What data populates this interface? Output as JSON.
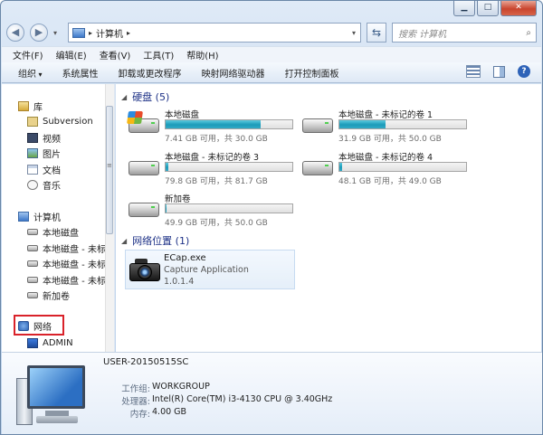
{
  "window": {
    "minimize": "▁",
    "maximize": "□",
    "close": "✕"
  },
  "nav": {
    "back": "◀",
    "forward": "▶",
    "history": "▾",
    "address": {
      "path": "计算机",
      "sep1": "▸",
      "sep2": "▸",
      "dropdown": "▾"
    },
    "refresh": "⇆",
    "search": {
      "placeholder": "搜索 计算机",
      "icon": "⌕"
    }
  },
  "menu": [
    "文件(F)",
    "编辑(E)",
    "查看(V)",
    "工具(T)",
    "帮助(H)"
  ],
  "toolbar": [
    "组织",
    "系统属性",
    "卸载或更改程序",
    "映射网络驱动器",
    "打开控制面板"
  ],
  "sidebar": {
    "library": "库",
    "library_items": [
      "Subversion",
      "视频",
      "图片",
      "文档",
      "音乐"
    ],
    "computer": "计算机",
    "computer_items": [
      "本地磁盘",
      "本地磁盘 - 未标记",
      "本地磁盘 - 未标记",
      "本地磁盘 - 未标记",
      "新加卷"
    ],
    "network": "网络",
    "network_items": [
      "ADMIN"
    ],
    "scroll_grip": "≡"
  },
  "content": {
    "hard_disks_title": "硬盘 (5)",
    "drives": [
      {
        "name": "本地磁盘",
        "free": "7.41 GB 可用，共 30.0 GB",
        "used_pct": 75.3
      },
      {
        "name": "本地磁盘 - 未标记的卷 1",
        "free": "31.9 GB 可用，共 50.0 GB",
        "used_pct": 36.2
      },
      {
        "name": "本地磁盘 - 未标记的卷 3",
        "free": "79.8 GB 可用，共 81.7 GB",
        "used_pct": 2.3
      },
      {
        "name": "本地磁盘 - 未标记的卷 4",
        "free": "48.1 GB 可用，共 49.0 GB",
        "used_pct": 1.8
      },
      {
        "name": "新加卷",
        "free": "49.9 GB 可用，共 50.0 GB",
        "used_pct": 0.2
      }
    ],
    "network_title": "网络位置 (1)",
    "network_item": {
      "name": "ECap.exe",
      "desc": "Capture Application",
      "version": "1.0.1.4"
    }
  },
  "details": {
    "pc_name": "USER-20150515SC",
    "workgroup_label": "工作组:",
    "workgroup": "WORKGROUP",
    "cpu_label": "处理器:",
    "cpu": "Intel(R) Core(TM) i3-4130 CPU @ 3.40GHz",
    "mem_label": "内存:",
    "mem": "4.00 GB"
  },
  "colors": {
    "accent_title": "#1e3287",
    "disk_fill": "#1c9bb9",
    "highlight_box": "#d9222a"
  }
}
